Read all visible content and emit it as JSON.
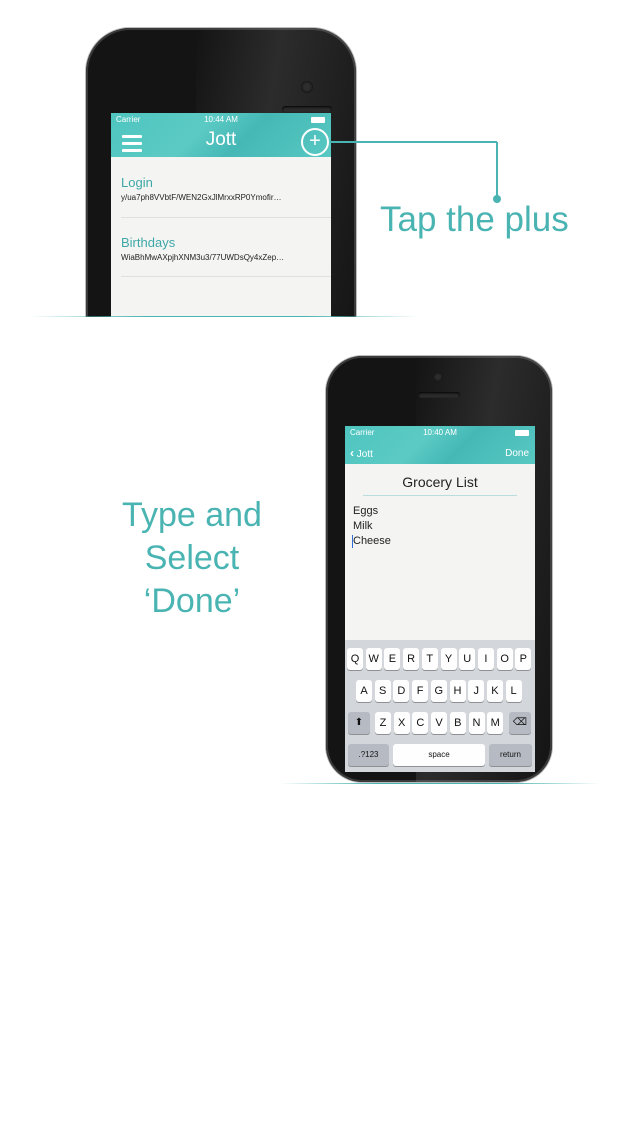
{
  "phone1": {
    "status": {
      "carrier": "Carrier",
      "time": "10:44 AM"
    },
    "title": "Jott",
    "menu_icon": "hamburger-menu-icon",
    "add_icon": "plus-circle-icon",
    "notes": [
      {
        "title": "Login",
        "preview": "y/ua7ph8VVbtF/WEN2GxJlMrxxRP0Ymofir…"
      },
      {
        "title": "Birthdays",
        "preview": "WiaBhMwAXpjhXNM3u3/77UWDsQy4xZep…"
      }
    ]
  },
  "callout1": "Tap the plus",
  "callout2": {
    "line1": "Type and",
    "line2": "Select",
    "line3": "‘Done’"
  },
  "phone2": {
    "status": {
      "carrier": "Carrier",
      "time": "10:40 AM"
    },
    "back_label": "Jott",
    "back_icon": "chevron-left-icon",
    "done_label": "Done",
    "note_title": "Grocery List",
    "lines": [
      "Eggs",
      "Milk",
      "Cheese"
    ],
    "keyboard": {
      "row1": [
        "Q",
        "W",
        "E",
        "R",
        "T",
        "Y",
        "U",
        "I",
        "O",
        "P"
      ],
      "row2": [
        "A",
        "S",
        "D",
        "F",
        "G",
        "H",
        "J",
        "K",
        "L"
      ],
      "row3": [
        "Z",
        "X",
        "C",
        "V",
        "B",
        "N",
        "M"
      ],
      "shift_icon": "shift-arrow-icon",
      "delete_icon": "backspace-icon",
      "numbers_label": ".?123",
      "space_label": "space",
      "return_label": "return"
    }
  },
  "colors": {
    "accent": "#4ab4b2",
    "navbar": "#52c3bf"
  }
}
